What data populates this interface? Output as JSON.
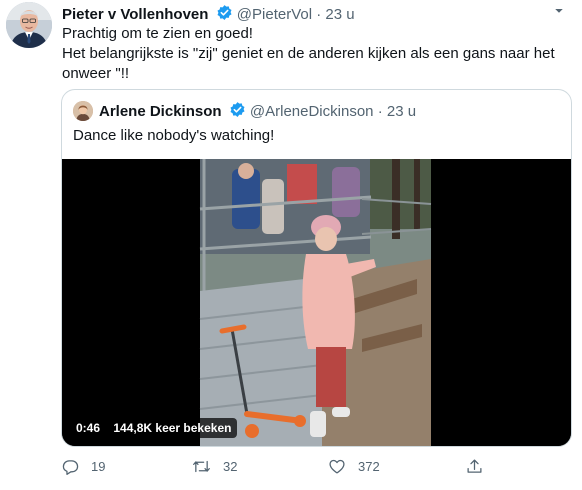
{
  "tweet": {
    "author_name": "Pieter v Vollenhoven",
    "author_handle": "@PieterVol",
    "separator": "·",
    "time": "23 u",
    "text_line1": "Prachtig om te zien en goed!",
    "text_line2": "Het belangrijkste is \"zij\" geniet en de anderen kijken als een gans naar het",
    "text_line3": "onweer \"!!"
  },
  "quoted": {
    "author_name": "Arlene Dickinson",
    "author_handle": "@ArleneDickinson",
    "separator": "·",
    "time": "23 u",
    "text": "Dance like nobody's watching!",
    "video": {
      "duration": "0:46",
      "views": "144,8K keer bekeken"
    }
  },
  "actions": {
    "reply_count": "19",
    "retweet_count": "32",
    "like_count": "372"
  },
  "colors": {
    "verified": "#1d9bf0",
    "secondary_text": "#536471",
    "border": "#cfd9de"
  },
  "icons": [
    "more-icon",
    "verified-icon",
    "reply-icon",
    "retweet-icon",
    "like-icon",
    "share-icon"
  ]
}
